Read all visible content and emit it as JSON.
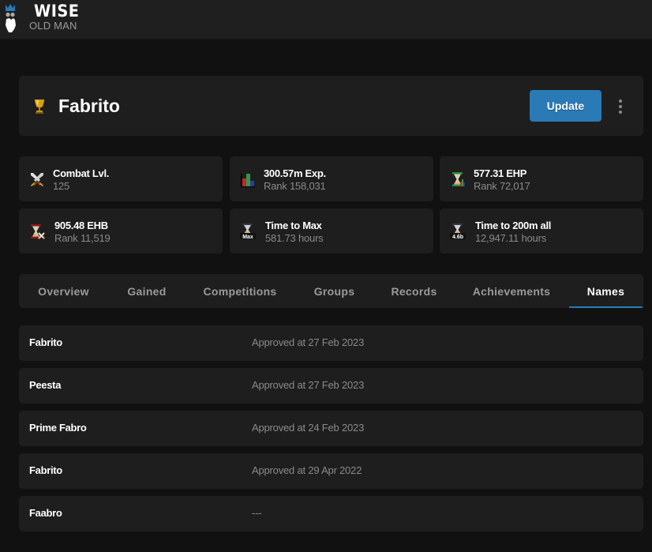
{
  "app": {
    "logo_title": "WISE",
    "logo_subtitle": "OLD MAN"
  },
  "player": {
    "name": "Fabrito",
    "badge_icon": "trophy-icon",
    "update_label": "Update",
    "more_icon": "more-vertical-icon"
  },
  "stats": [
    {
      "icon": "crossed-swords-icon",
      "title": "Combat Lvl.",
      "sub": "125"
    },
    {
      "icon": "bar-chart-icon",
      "title": "300.57m Exp.",
      "sub": "Rank 158,031"
    },
    {
      "icon": "hourglass-ehp-icon",
      "title": "577.31 EHP",
      "sub": "Rank 72,017"
    },
    {
      "icon": "hourglass-ehb-icon",
      "title": "905.48 EHB",
      "sub": "Rank 11,519"
    },
    {
      "icon": "hourglass-max-icon",
      "title": "Time to Max",
      "sub": "581.73 hours"
    },
    {
      "icon": "hourglass-200m-icon",
      "title": "Time to 200m all",
      "sub": "12,947.11 hours"
    }
  ],
  "icon_labels": {
    "max": "Max",
    "two_hundred_m": "4.6b"
  },
  "tabs": [
    {
      "label": "Overview",
      "active": false
    },
    {
      "label": "Gained",
      "active": false
    },
    {
      "label": "Competitions",
      "active": false
    },
    {
      "label": "Groups",
      "active": false
    },
    {
      "label": "Records",
      "active": false
    },
    {
      "label": "Achievements",
      "active": false
    },
    {
      "label": "Names",
      "active": true
    }
  ],
  "names": [
    {
      "name": "Fabrito",
      "status": "Approved at 27 Feb 2023"
    },
    {
      "name": "Peesta",
      "status": "Approved at 27 Feb 2023"
    },
    {
      "name": "Prime Fabro",
      "status": "Approved at 24 Feb 2023"
    },
    {
      "name": "Fabrito",
      "status": "Approved at 29 Apr 2022"
    },
    {
      "name": "Faabro",
      "status": "---"
    }
  ],
  "colors": {
    "accent": "#2a7ab6",
    "background": "#111111",
    "card": "#1e1e1e",
    "muted_text": "#8a8a8a"
  }
}
